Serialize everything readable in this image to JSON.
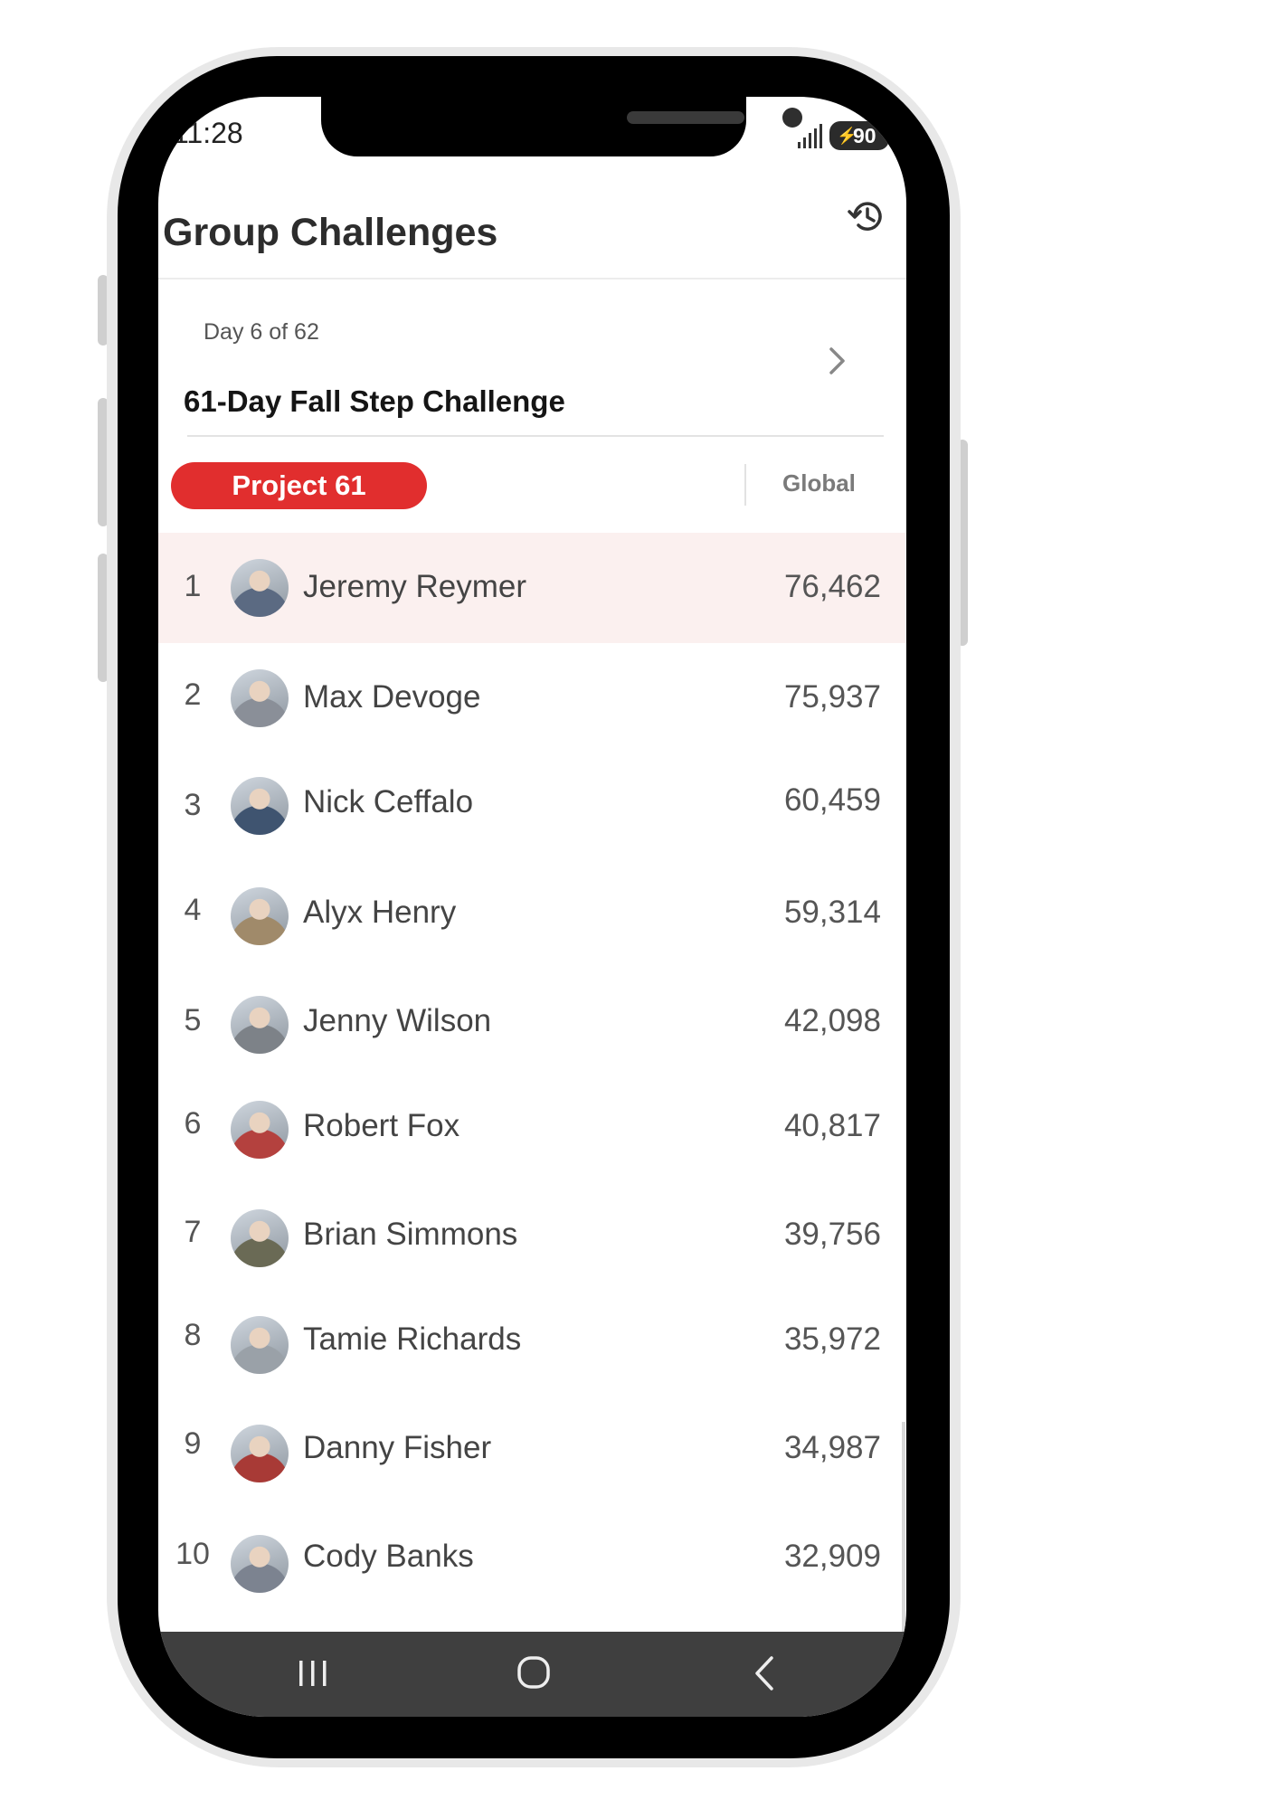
{
  "status_bar": {
    "time": "11:28",
    "battery": "90"
  },
  "header": {
    "title": "Group Challenges",
    "history_icon": "history-icon"
  },
  "challenge": {
    "day_label": "Day 6 of 62",
    "name": "61-Day Fall Step Challenge"
  },
  "tabs": {
    "active": "Project 61",
    "other": "Global"
  },
  "leaderboard": [
    {
      "rank": "1",
      "name": "Jeremy Reymer",
      "steps": "76,462",
      "highlight": true,
      "avatar_color": "#5b6a82"
    },
    {
      "rank": "2",
      "name": "Max  Devoge",
      "steps": "75,937",
      "highlight": false,
      "avatar_color": "#8a8f98"
    },
    {
      "rank": "3",
      "name": "Nick Ceffalo",
      "steps": "60,459",
      "highlight": false,
      "avatar_color": "#3f5470"
    },
    {
      "rank": "4",
      "name": "Alyx Henry",
      "steps": "59,314",
      "highlight": false,
      "avatar_color": "#a08a6a"
    },
    {
      "rank": "5",
      "name": "Jenny Wilson",
      "steps": "42,098",
      "highlight": false,
      "avatar_color": "#7d8288"
    },
    {
      "rank": "6",
      "name": "Robert Fox",
      "steps": "40,817",
      "highlight": false,
      "avatar_color": "#b4413e"
    },
    {
      "rank": "7",
      "name": "Brian Simmons",
      "steps": "39,756",
      "highlight": false,
      "avatar_color": "#6a6a55"
    },
    {
      "rank": "8",
      "name": "Tamie Richards",
      "steps": "35,972",
      "highlight": false,
      "avatar_color": "#9aa1a8"
    },
    {
      "rank": "9",
      "name": "Danny Fisher",
      "steps": "34,987",
      "highlight": false,
      "avatar_color": "#a83a36"
    },
    {
      "rank": "10",
      "name": "Cody Banks",
      "steps": "32,909",
      "highlight": false,
      "avatar_color": "#7c8390"
    }
  ],
  "nav": {
    "recents_icon": "recents-icon",
    "home_icon": "home-icon",
    "back_icon": "back-icon"
  },
  "colors": {
    "accent": "#e12e2e",
    "highlight_row": "#fbf0ef"
  }
}
